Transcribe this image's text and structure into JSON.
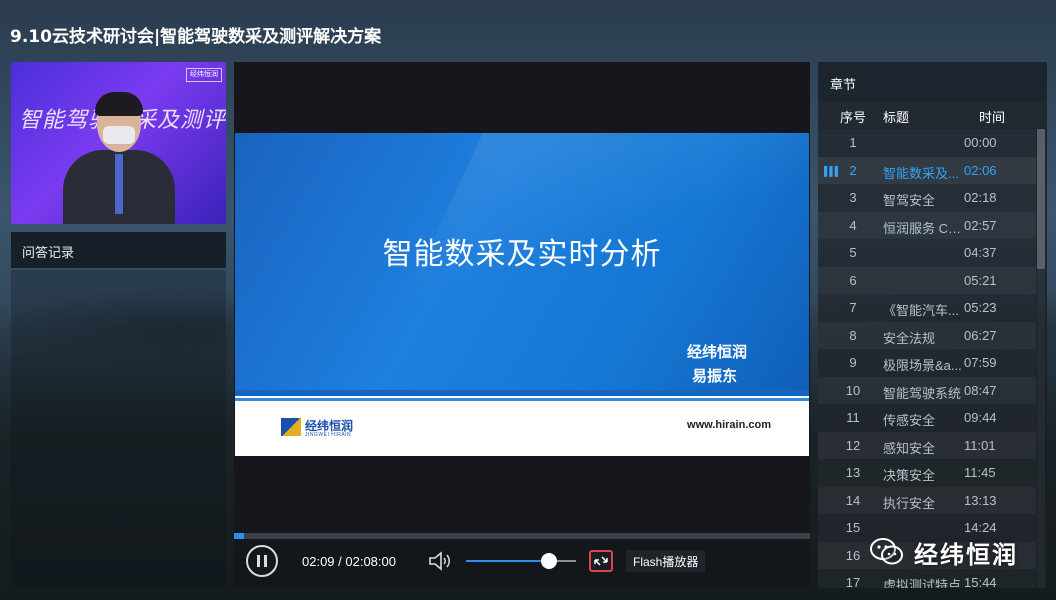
{
  "page": {
    "title": "9.10云技术研讨会|智能驾驶数采及测评解决方案"
  },
  "camera": {
    "overlay_text": "智能驾驶数采及测评解决方案",
    "logo_text": "经纬恒润"
  },
  "qa": {
    "label": "问答记录"
  },
  "slide": {
    "title": "智能数采及实时分析",
    "company": "经纬恒润",
    "author": "易振东",
    "logo_text": "经纬恒润",
    "logo_sub": "JINGWEI HIRAIN",
    "url": "www.hirain.com"
  },
  "player": {
    "time": "02:09 / 02:08:00",
    "progress_fraction": 0.0168,
    "volume_fraction": 0.76,
    "flash_label": "Flash播放器",
    "pause_icon": "pause-icon",
    "volume_icon": "speaker-icon",
    "fullscreen_icon": "exit-fullscreen-icon"
  },
  "chapters": {
    "title": "章节",
    "columns": {
      "no": "序号",
      "title": "标题",
      "time": "时间"
    },
    "active_index": 1,
    "items": [
      {
        "no": "1",
        "title": "",
        "time": "00:00"
      },
      {
        "no": "2",
        "title": "智能数采及...",
        "time": "02:06"
      },
      {
        "no": "3",
        "title": "智驾安全",
        "time": "02:18"
      },
      {
        "no": "4",
        "title": "恒润服务 CL...",
        "time": "02:57"
      },
      {
        "no": "5",
        "title": "",
        "time": "04:37"
      },
      {
        "no": "6",
        "title": "",
        "time": "05:21"
      },
      {
        "no": "7",
        "title": "《智能汽车...",
        "time": "05:23"
      },
      {
        "no": "8",
        "title": "安全法规",
        "time": "06:27"
      },
      {
        "no": "9",
        "title": "极限场景&a...",
        "time": "07:59"
      },
      {
        "no": "10",
        "title": "智能驾驶系统",
        "time": "08:47"
      },
      {
        "no": "11",
        "title": "传感安全",
        "time": "09:44"
      },
      {
        "no": "12",
        "title": "感知安全",
        "time": "11:01"
      },
      {
        "no": "13",
        "title": "决策安全",
        "time": "11:45"
      },
      {
        "no": "14",
        "title": "执行安全",
        "time": "13:13"
      },
      {
        "no": "15",
        "title": "",
        "time": "14:24"
      },
      {
        "no": "16",
        "title": "",
        "time": ""
      },
      {
        "no": "17",
        "title": "虚拟测试特点",
        "time": "15:44"
      }
    ]
  },
  "watermark": {
    "text": "经纬恒润",
    "icon": "wechat-icon"
  },
  "colors": {
    "accent": "#35a3f5",
    "slide_blue": "#1e7fdd",
    "fullscreen_red": "#e0434c"
  }
}
